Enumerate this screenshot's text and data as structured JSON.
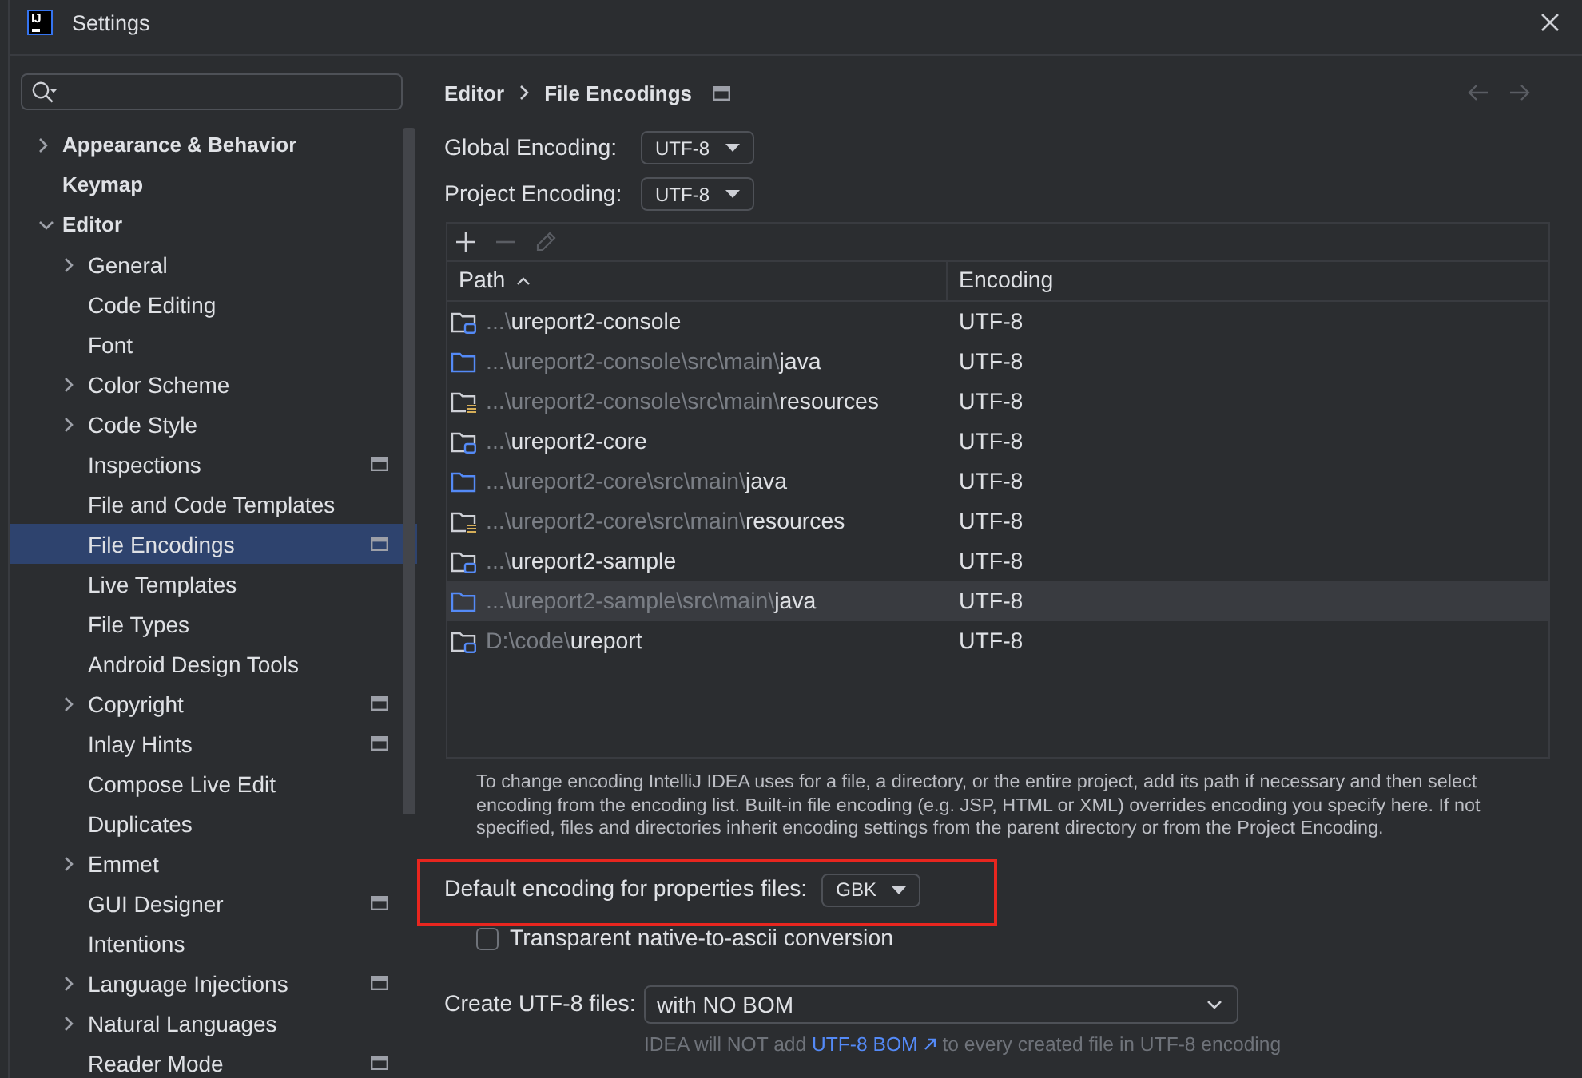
{
  "window": {
    "title": "Settings",
    "logo": "IJ"
  },
  "sidebar": {
    "items": [
      {
        "label": "Appearance & Behavior",
        "expanded": false,
        "selected": false,
        "project_scope": false
      },
      {
        "label": "Keymap",
        "selected": false,
        "project_scope": false
      },
      {
        "label": "Editor",
        "expanded": true,
        "selected": false,
        "project_scope": false,
        "children": [
          {
            "label": "General",
            "expanded": false,
            "selected": false,
            "project_scope": false
          },
          {
            "label": "Code Editing",
            "selected": false,
            "project_scope": false
          },
          {
            "label": "Font",
            "selected": false,
            "project_scope": false
          },
          {
            "label": "Color Scheme",
            "expanded": false,
            "selected": false,
            "project_scope": false
          },
          {
            "label": "Code Style",
            "expanded": false,
            "selected": false,
            "project_scope": false
          },
          {
            "label": "Inspections",
            "selected": false,
            "project_scope": true
          },
          {
            "label": "File and Code Templates",
            "selected": false,
            "project_scope": false
          },
          {
            "label": "File Encodings",
            "selected": true,
            "project_scope": true
          },
          {
            "label": "Live Templates",
            "selected": false,
            "project_scope": false
          },
          {
            "label": "File Types",
            "selected": false,
            "project_scope": false
          },
          {
            "label": "Android Design Tools",
            "selected": false,
            "project_scope": false
          },
          {
            "label": "Copyright",
            "expanded": false,
            "selected": false,
            "project_scope": true
          },
          {
            "label": "Inlay Hints",
            "selected": false,
            "project_scope": true
          },
          {
            "label": "Compose Live Edit",
            "selected": false,
            "project_scope": false
          },
          {
            "label": "Duplicates",
            "selected": false,
            "project_scope": false
          },
          {
            "label": "Emmet",
            "expanded": false,
            "selected": false,
            "project_scope": false
          },
          {
            "label": "GUI Designer",
            "selected": false,
            "project_scope": true
          },
          {
            "label": "Intentions",
            "selected": false,
            "project_scope": false
          },
          {
            "label": "Language Injections",
            "expanded": false,
            "selected": false,
            "project_scope": true
          },
          {
            "label": "Natural Languages",
            "expanded": false,
            "selected": false,
            "project_scope": false
          },
          {
            "label": "Reader Mode",
            "selected": false,
            "project_scope": true
          }
        ]
      }
    ]
  },
  "header": {
    "breadcrumb": [
      {
        "label": "Editor"
      },
      {
        "label": "File Encodings"
      }
    ],
    "project_scope": true,
    "nav_buttons": [
      {
        "kind": "back",
        "disabled": true
      },
      {
        "kind": "forward",
        "disabled": true
      }
    ]
  },
  "encodings": [
    {
      "label": "Global Encoding:",
      "value": "UTF-8"
    },
    {
      "label": "Project Encoding:",
      "value": "UTF-8"
    }
  ],
  "table": {
    "toolbar": [
      {
        "kind": "add",
        "disabled": false
      },
      {
        "kind": "remove",
        "disabled": true
      },
      {
        "kind": "edit",
        "disabled": true
      }
    ],
    "columns": [
      {
        "label": "Path",
        "sorted": true
      },
      {
        "label": "Encoding",
        "sorted": false
      }
    ],
    "rows": [
      {
        "kind": "module",
        "dir": "...\\",
        "name": "ureport2-console",
        "encoding": "UTF-8",
        "selected": false
      },
      {
        "kind": "source",
        "dir": "...\\ureport2-console\\src\\main\\",
        "name": "java",
        "encoding": "UTF-8",
        "selected": false
      },
      {
        "kind": "resources",
        "dir": "...\\ureport2-console\\src\\main\\",
        "name": "resources",
        "encoding": "UTF-8",
        "selected": false
      },
      {
        "kind": "module",
        "dir": "...\\",
        "name": "ureport2-core",
        "encoding": "UTF-8",
        "selected": false
      },
      {
        "kind": "source",
        "dir": "...\\ureport2-core\\src\\main\\",
        "name": "java",
        "encoding": "UTF-8",
        "selected": false
      },
      {
        "kind": "resources",
        "dir": "...\\ureport2-core\\src\\main\\",
        "name": "resources",
        "encoding": "UTF-8",
        "selected": false
      },
      {
        "kind": "module",
        "dir": "...\\",
        "name": "ureport2-sample",
        "encoding": "UTF-8",
        "selected": false
      },
      {
        "kind": "source",
        "dir": "...\\ureport2-sample\\src\\main\\",
        "name": "java",
        "encoding": "UTF-8",
        "selected": true
      },
      {
        "kind": "module",
        "dir": "D:\\code\\",
        "name": "ureport",
        "encoding": "UTF-8",
        "selected": false
      }
    ]
  },
  "help_text": "To change encoding IntelliJ IDEA uses for a file, a directory, or the entire project, add its path if necessary and then select encoding from the encoding list. Built-in file encoding (e.g. JSP, HTML or XML) overrides encoding you specify here. If not specified, files and directories inherit encoding settings from the parent directory or from the Project Encoding.",
  "properties": {
    "label": "Default encoding for properties files:",
    "value": "GBK",
    "highlighted": true
  },
  "native_to_ascii": {
    "label": "Transparent native-to-ascii conversion",
    "checked": false
  },
  "bom": {
    "label": "Create UTF-8 files:",
    "value": "with NO BOM",
    "hint": {
      "before": "IDEA will NOT add ",
      "link": "UTF-8 BOM",
      "after": " to every created file in UTF-8 encoding"
    }
  }
}
